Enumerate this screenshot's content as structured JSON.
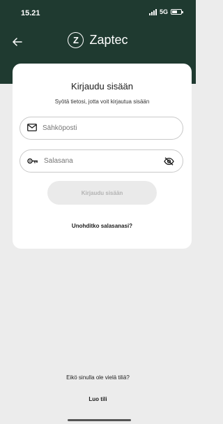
{
  "status_bar": {
    "time": "15.21",
    "network": "5G"
  },
  "header": {
    "brand_initial": "Z",
    "brand_name": "Zaptec"
  },
  "login_card": {
    "title": "Kirjaudu sisään",
    "subtitle": "Syötä tietosi, jotta voit kirjautua sisään",
    "email_placeholder": "Sähköposti",
    "password_placeholder": "Salasana",
    "submit_label": "Kirjaudu sisään",
    "forgot_label": "Unohditko salasanasi?"
  },
  "footer": {
    "no_account_text": "Eikö sinulla ole vielä tiliä?",
    "create_label": "Luo tili"
  },
  "colors": {
    "header_bg": "#1f3a30",
    "page_bg": "#ececec",
    "card_bg": "#ffffff",
    "button_disabled": "#eaeaea"
  }
}
